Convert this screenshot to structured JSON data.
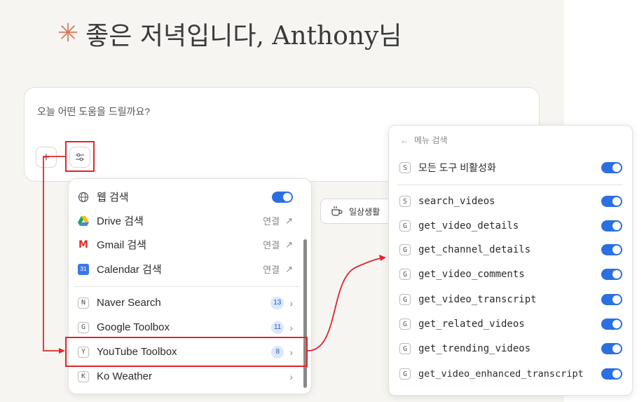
{
  "greeting": {
    "star": "✳",
    "text": "좋은 저녁입니다, Anthony님"
  },
  "prompt": {
    "placeholder": "오늘 어떤 도움을 드릴까요?",
    "plus": "+",
    "tools": "⚙"
  },
  "suggestion_chip": {
    "label": "일상생활"
  },
  "dropdown": {
    "items": [
      {
        "label": "웹 검색",
        "right": ""
      },
      {
        "label": "Drive 검색",
        "right": "연결"
      },
      {
        "label": "Gmail 검색",
        "right": "연결"
      },
      {
        "label": "Calendar 검색",
        "right": "연결"
      },
      {
        "icon_letter": "N",
        "label": "Naver Search",
        "badge": "13"
      },
      {
        "icon_letter": "G",
        "label": "Google Toolbox",
        "badge": "11"
      },
      {
        "icon_letter": "Y",
        "label": "YouTube Toolbox",
        "badge": "8"
      },
      {
        "icon_letter": "K",
        "label": "Ko Weather",
        "badge": ""
      }
    ],
    "external_icon": "↗",
    "chevron": "›"
  },
  "submenu": {
    "back_arrow": "←",
    "search_placeholder": "메뉴 검색",
    "disable_all": {
      "icon_letter": "S",
      "label": "모든 도구 비활성화"
    },
    "tools": [
      {
        "icon_letter": "S",
        "label": "search_videos"
      },
      {
        "icon_letter": "G",
        "label": "get_video_details"
      },
      {
        "icon_letter": "G",
        "label": "get_channel_details"
      },
      {
        "icon_letter": "G",
        "label": "get_video_comments"
      },
      {
        "icon_letter": "G",
        "label": "get_video_transcript"
      },
      {
        "icon_letter": "G",
        "label": "get_related_videos"
      },
      {
        "icon_letter": "G",
        "label": "get_trending_videos"
      },
      {
        "icon_letter": "G",
        "label": "get_video_enhanced_transcript"
      }
    ]
  },
  "colors": {
    "accent_toggle": "#2b6fe0",
    "annotation_red": "#e0262b",
    "star": "#d9785a"
  }
}
